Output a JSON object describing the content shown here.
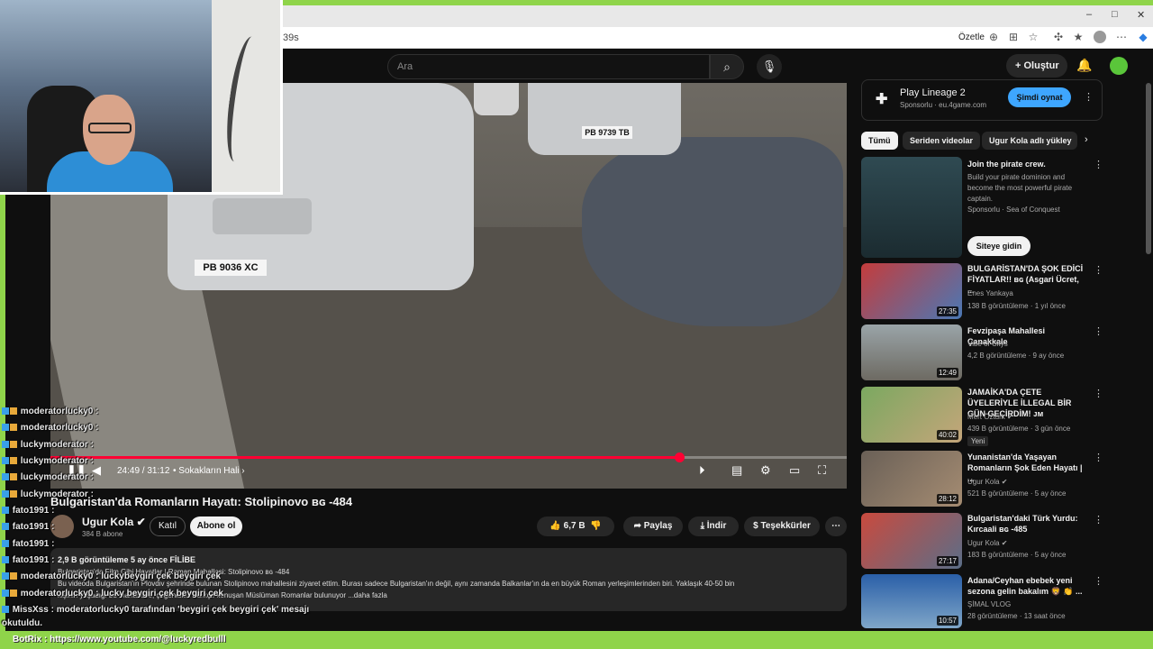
{
  "browser": {
    "url_fragment": "39s",
    "summarize": "Özetle",
    "win_min": "–",
    "win_max": "□",
    "win_close": "✕"
  },
  "header": {
    "search_placeholder": "Ara",
    "create_label": "Oluştur"
  },
  "video": {
    "plate_left": "PB 9036 XC",
    "plate_center": "PB 9739 TB",
    "progress": 0.79,
    "time": "24:49 / 31:12",
    "chapter": "• Sokakların Hali ›",
    "title": "Bulgaristan'da Romanların Hayatı: Stolipinovo ʙɢ -484",
    "channel": "Ugur Kola ✔",
    "subs": "384 B abone",
    "join": "Katıl",
    "subscribe": "Abone ol",
    "likes": "6,7 B",
    "share": "Paylaş",
    "download": "İndir",
    "thanks": "Teşekkürler",
    "views_line": "2,9 B görüntüleme  5 ay önce  FİLİBE",
    "desc1": "Bulgaristan'da Film Gibi Hayatlar | Roman Mahallesi: Stolipinovo ʙɢ -484",
    "desc2": "Bu videoda Bulgaristan'ın Plovdiv şehrinde bulunan Stolipinovo mahallesini ziyaret ettim. Burası sadece Bulgaristan'ın değil, aynı zamanda Balkanlar'ın da en büyük Roman yerleşimlerinden biri. Yaklaşık 40-50 bin",
    "desc3": "kişinin yaşadığı bu mahallede, çoğunlukla Türkçe konuşan Müslüman Romanlar bulunuyor  ...daha fazla"
  },
  "chat": [
    {
      "user": "moderatorlucky0 :",
      "msg": ""
    },
    {
      "user": "moderatorlucky0 :",
      "msg": ""
    },
    {
      "user": "luckymoderator :",
      "msg": ""
    },
    {
      "user": "luckymoderator :",
      "msg": ""
    },
    {
      "user": "luckymoderator :",
      "msg": ""
    },
    {
      "user": "luckymoderator :",
      "msg": ""
    },
    {
      "user": "fato1991 :",
      "msg": ""
    },
    {
      "user": "fato1991 :",
      "msg": ""
    },
    {
      "user": "fato1991 :",
      "msg": ""
    },
    {
      "user": "fato1991 :",
      "msg": ""
    },
    {
      "user": "moderatorlucky0 :",
      "msg": "luckybeygiri çek beygiri çek"
    },
    {
      "user": "moderatorlucky0 :",
      "msg": "lucky beygiri çek beygiri çek"
    },
    {
      "user": "MissXss :",
      "msg": "moderatorlucky0 tarafından 'beygiri çek beygiri çek' mesajı"
    },
    {
      "user": "",
      "msg": "okutuldu."
    }
  ],
  "bottom_bar": "BotRix : https://www.youtube.com/@luckyredbulll",
  "sidebar": {
    "ad": {
      "title": "Play Lineage 2",
      "sponsor": "Sponsorlu · eu.4game.com",
      "button": "Şimdi oynat"
    },
    "chips": [
      "Tümü",
      "Seriden videolar",
      "Ugur Kola adlı yükley"
    ],
    "videos": [
      {
        "title": "Join the pirate crew.",
        "channel": "Build your pirate dominion and become the most powerful pirate captain.",
        "meta": "Sponsorlu · Sea of Conquest",
        "duration": "",
        "button": "Siteye gidin"
      },
      {
        "title": "BULGARİSTAN'DA ŞOK EDİCİ FİYATLAR!! ʙɢ (Asgari Ücret, ...",
        "channel": "Enes Yankaya",
        "meta": "138 B görüntüleme · 1 yıl önce",
        "duration": "27:35"
      },
      {
        "title": "Fevzipaşa Mahallesi Çanakkale",
        "channel": "Vibe of Citys",
        "meta": "4,2 B görüntüleme · 9 ay önce",
        "duration": "12:49"
      },
      {
        "title": "JAMAİKA'DA ÇETE ÜYELERİYLE İLLEGAL BİR GÜN GEÇİRDİM! ᴊᴍ",
        "channel": "Mert Öztürk ✔",
        "meta": "439 B görüntüleme · 3 gün önce",
        "duration": "40:02",
        "badge": "Yeni"
      },
      {
        "title": "Yunanistan'da Yaşayan Romanların Şok Eden Hayatı | ...",
        "channel": "Ugur Kola ✔",
        "meta": "521 B görüntüleme · 5 ay önce",
        "duration": "28:12"
      },
      {
        "title": "Bulgaristan'daki Türk Yurdu: Kırcaali ʙɢ -485",
        "channel": "Ugur Kola ✔",
        "meta": "183 B görüntüleme · 5 ay önce",
        "duration": "27:17"
      },
      {
        "title": "Adana/Ceyhan ebebek yeni sezona gelin bakalım 🦁 👏 ...",
        "channel": "ŞİMAL VLOG",
        "meta": "28 görüntüleme · 13 saat önce",
        "duration": "10:57"
      }
    ]
  }
}
